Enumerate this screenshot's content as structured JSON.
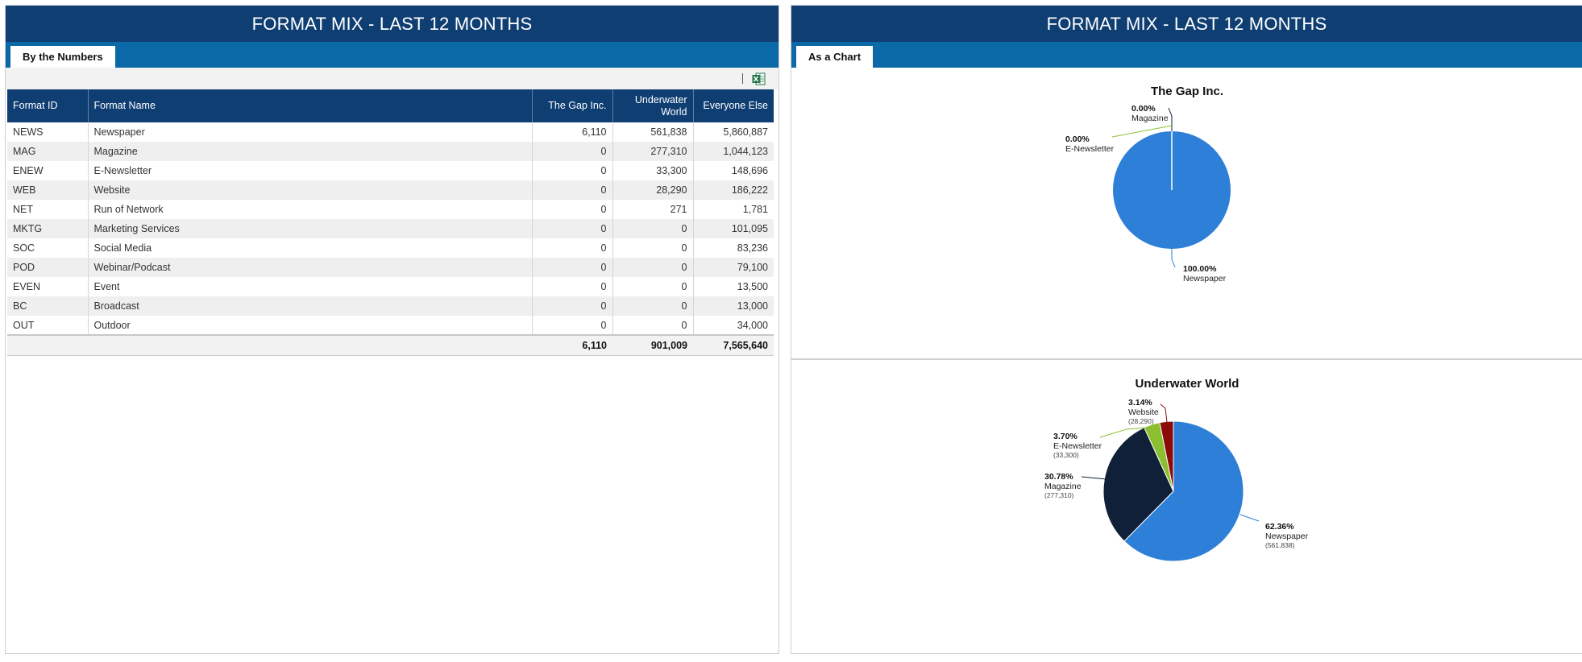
{
  "left_panel": {
    "title": "FORMAT MIX - LAST 12 MONTHS",
    "tab_label": "By the Numbers",
    "toolbar": {
      "export_icon": "excel-icon"
    },
    "columns": [
      "Format ID",
      "Format Name",
      "The Gap Inc.",
      "Underwater World",
      "Everyone Else"
    ],
    "rows": [
      [
        "NEWS",
        "Newspaper",
        "6,110",
        "561,838",
        "5,860,887"
      ],
      [
        "MAG",
        "Magazine",
        "0",
        "277,310",
        "1,044,123"
      ],
      [
        "ENEW",
        "E-Newsletter",
        "0",
        "33,300",
        "148,696"
      ],
      [
        "WEB",
        "Website",
        "0",
        "28,290",
        "186,222"
      ],
      [
        "NET",
        "Run of Network",
        "0",
        "271",
        "1,781"
      ],
      [
        "MKTG",
        "Marketing Services",
        "0",
        "0",
        "101,095"
      ],
      [
        "SOC",
        "Social Media",
        "0",
        "0",
        "83,236"
      ],
      [
        "POD",
        "Webinar/Podcast",
        "0",
        "0",
        "79,100"
      ],
      [
        "EVEN",
        "Event",
        "0",
        "0",
        "13,500"
      ],
      [
        "BC",
        "Broadcast",
        "0",
        "0",
        "13,000"
      ],
      [
        "OUT",
        "Outdoor",
        "0",
        "0",
        "34,000"
      ]
    ],
    "totals": [
      "",
      "",
      "6,110",
      "901,009",
      "7,565,640"
    ]
  },
  "right_panel": {
    "title": "FORMAT MIX - LAST 12 MONTHS",
    "tab_label": "As a Chart"
  },
  "colors": {
    "header_navy": "#0f3e73",
    "tab_bar_blue": "#0a69a6",
    "newspaper": "#2e7fd8",
    "magazine": "#0f2038",
    "e_newsletter": "#8cbf2f",
    "website": "#8b0a0a"
  },
  "chart_data": [
    {
      "type": "pie",
      "title": "The Gap Inc.",
      "slices": [
        {
          "name": "Newspaper",
          "value": 6110,
          "label": "100.00%"
        },
        {
          "name": "Magazine",
          "value": 0,
          "label": "0.00%"
        },
        {
          "name": "E-Newsletter",
          "value": 0,
          "label": "0.00%"
        }
      ]
    },
    {
      "type": "pie",
      "title": "Underwater World",
      "slices": [
        {
          "name": "Newspaper",
          "value": 561838,
          "label": "62.36%",
          "sublabel": "(561,838)"
        },
        {
          "name": "Magazine",
          "value": 277310,
          "label": "30.78%",
          "sublabel": "(277,310)"
        },
        {
          "name": "E-Newsletter",
          "value": 33300,
          "label": "3.70%",
          "sublabel": "(33,300)"
        },
        {
          "name": "Website",
          "value": 28290,
          "label": "3.14%",
          "sublabel": "(28,290)"
        }
      ]
    }
  ]
}
